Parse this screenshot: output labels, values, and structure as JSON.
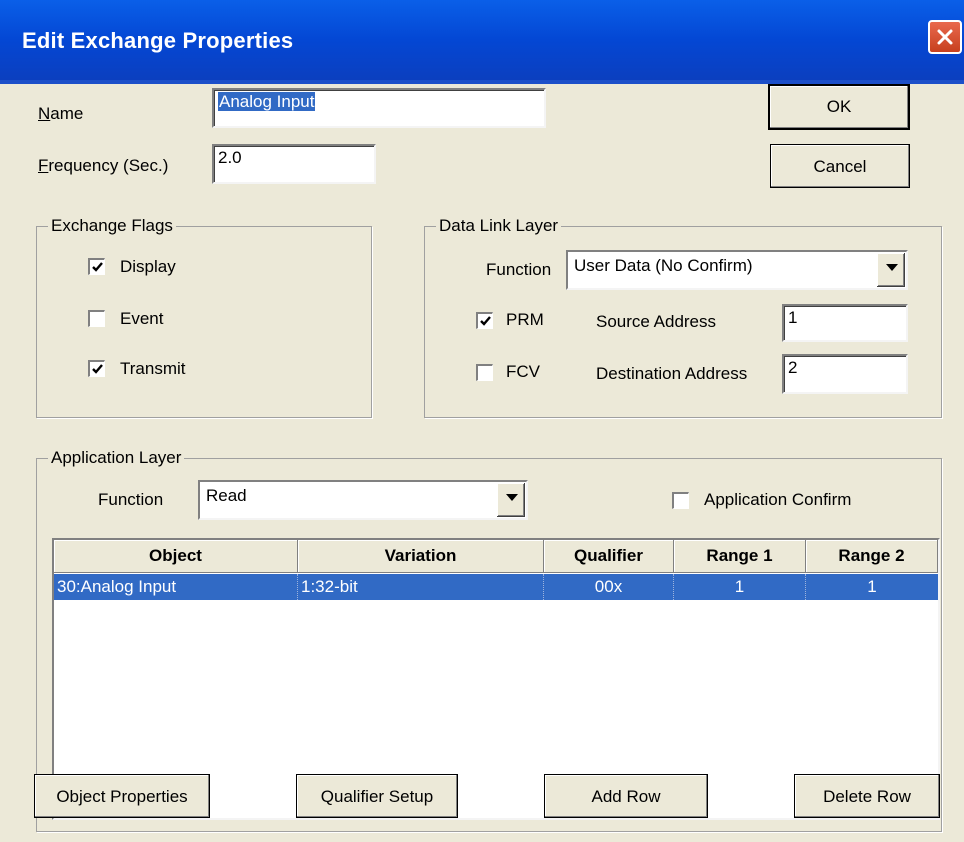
{
  "window": {
    "title": "Edit Exchange Properties"
  },
  "name": {
    "label_mnemonic": "N",
    "label_rest": "ame",
    "value": "Analog Input"
  },
  "frequency": {
    "label_mnemonic": "F",
    "label_rest": "requency (Sec.)",
    "value": "2.0"
  },
  "buttons": {
    "ok": "OK",
    "cancel": "Cancel",
    "object_properties": "Object Properties",
    "qualifier_setup": "Qualifier Setup",
    "add_row": "Add Row",
    "delete_row": "Delete Row"
  },
  "exchange_flags": {
    "title": "Exchange Flags",
    "display": {
      "label": "Display",
      "checked": true
    },
    "event": {
      "label": "Event",
      "checked": false
    },
    "transmit": {
      "label": "Transmit",
      "checked": true
    }
  },
  "data_link_layer": {
    "title": "Data Link Layer",
    "function_label": "Function",
    "function_value": "User Data (No Confirm)",
    "prm": {
      "label": "PRM",
      "checked": true
    },
    "fcv": {
      "label": "FCV",
      "checked": false
    },
    "source_address_label": "Source Address",
    "source_address": "1",
    "destination_address_label": "Destination Address",
    "destination_address": "2"
  },
  "application_layer": {
    "title": "Application Layer",
    "function_label": "Function",
    "function_value": "Read",
    "confirm": {
      "label": "Application Confirm",
      "checked": false
    },
    "table": {
      "columns": [
        "Object",
        "Variation",
        "Qualifier",
        "Range 1",
        "Range 2"
      ],
      "rows": [
        {
          "object": "30:Analog Input",
          "variation": "1:32-bit",
          "qualifier": "00x",
          "range1": "1",
          "range2": "1",
          "selected": true
        }
      ]
    }
  },
  "colors": {
    "titlebar": "#0447d4",
    "selection": "#316ac5",
    "dialog_bg": "#ece9d8",
    "close_button": "#d9532f"
  }
}
